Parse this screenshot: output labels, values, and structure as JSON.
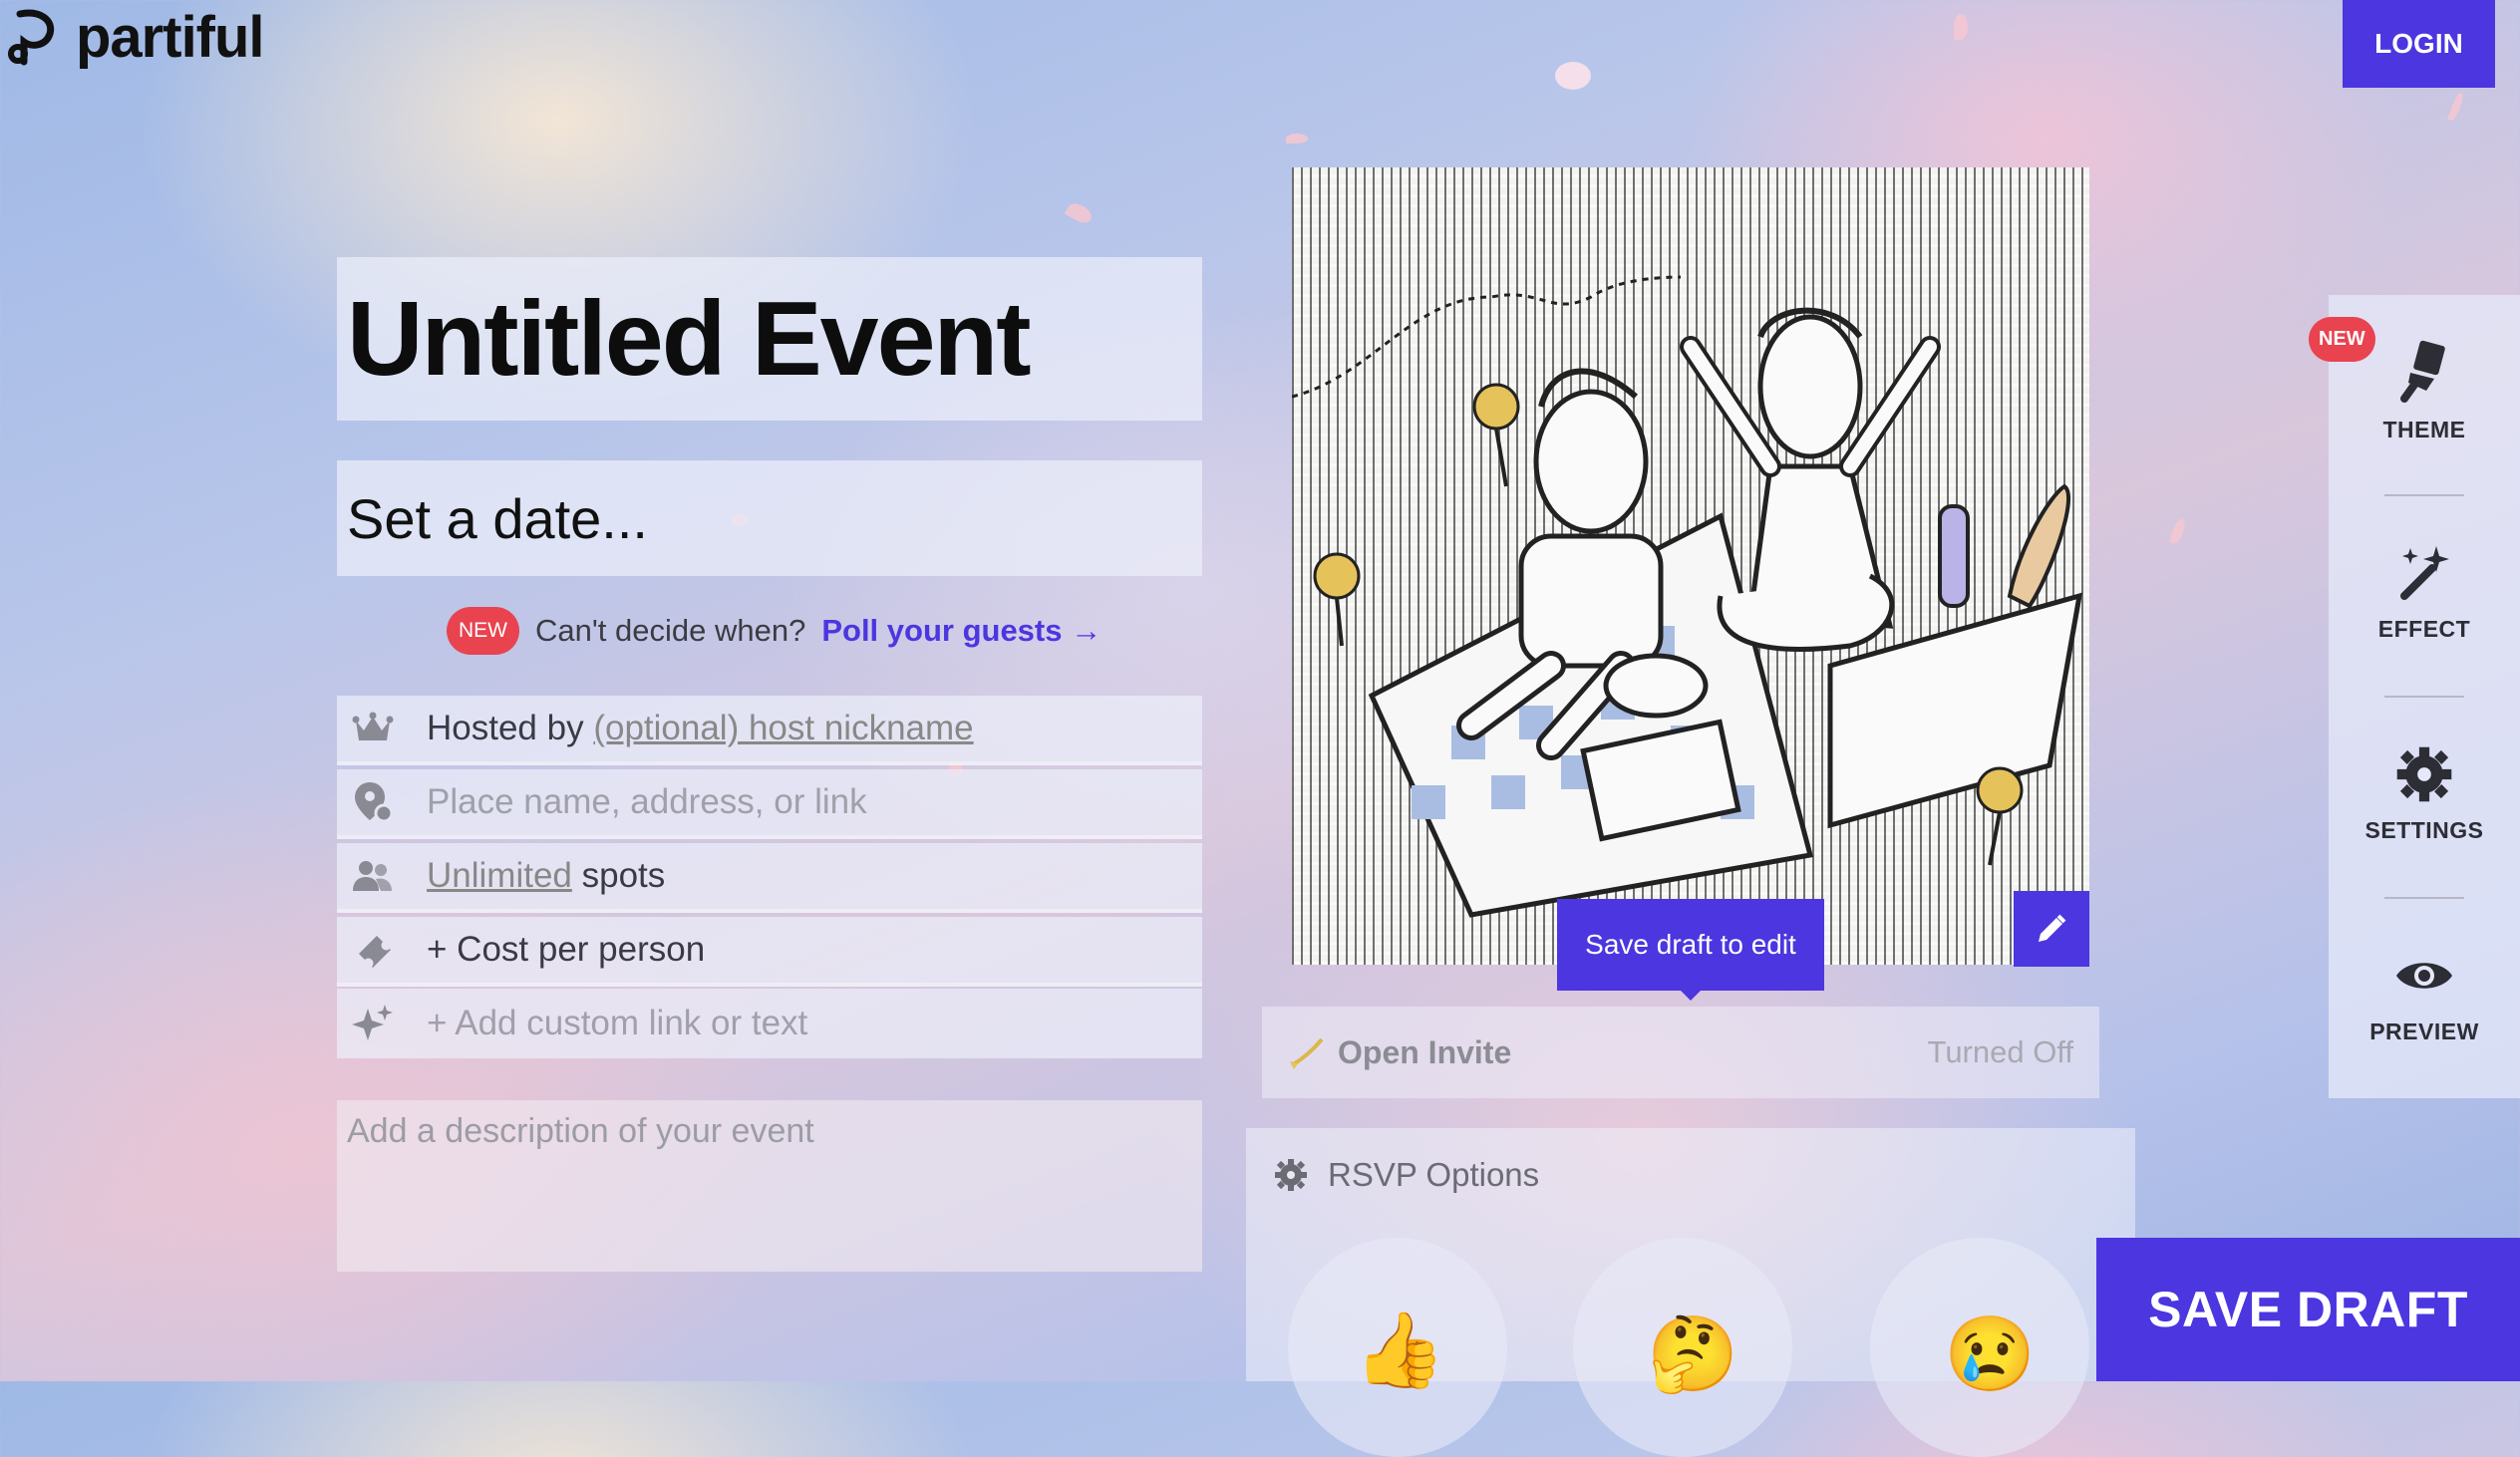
{
  "app": {
    "brand": "partiful",
    "login_label": "LOGIN"
  },
  "event": {
    "title": "Untitled Event",
    "date_placeholder": "Set a date...",
    "poll": {
      "badge": "NEW",
      "question": "Can't decide when?",
      "link": "Poll your guests →"
    },
    "fields": {
      "hosted_prefix": "Hosted by",
      "host_placeholder": "(optional) host nickname",
      "location_placeholder": "Place name, address, or link",
      "spots_value": "Unlimited",
      "spots_suffix": "spots",
      "cost_label": "+ Cost per person",
      "custom_link_label": "+ Add custom link or text"
    },
    "description_placeholder": "Add a description of your event"
  },
  "image": {
    "tooltip": "Save draft to edit"
  },
  "open_invite": {
    "label": "Open Invite",
    "status": "Turned Off"
  },
  "rsvp": {
    "title": "RSVP Options",
    "options": [
      "👍",
      "🤔",
      "😢"
    ]
  },
  "save_draft_label": "SAVE DRAFT",
  "sidebar": {
    "badge": "NEW",
    "items": [
      {
        "label": "THEME",
        "icon": "paintbrush-icon"
      },
      {
        "label": "EFFECT",
        "icon": "magic-wand-icon"
      },
      {
        "label": "SETTINGS",
        "icon": "gear-icon"
      },
      {
        "label": "PREVIEW",
        "icon": "eye-icon"
      }
    ]
  },
  "colors": {
    "accent": "#4b36e0",
    "badge": "#e8434f"
  }
}
